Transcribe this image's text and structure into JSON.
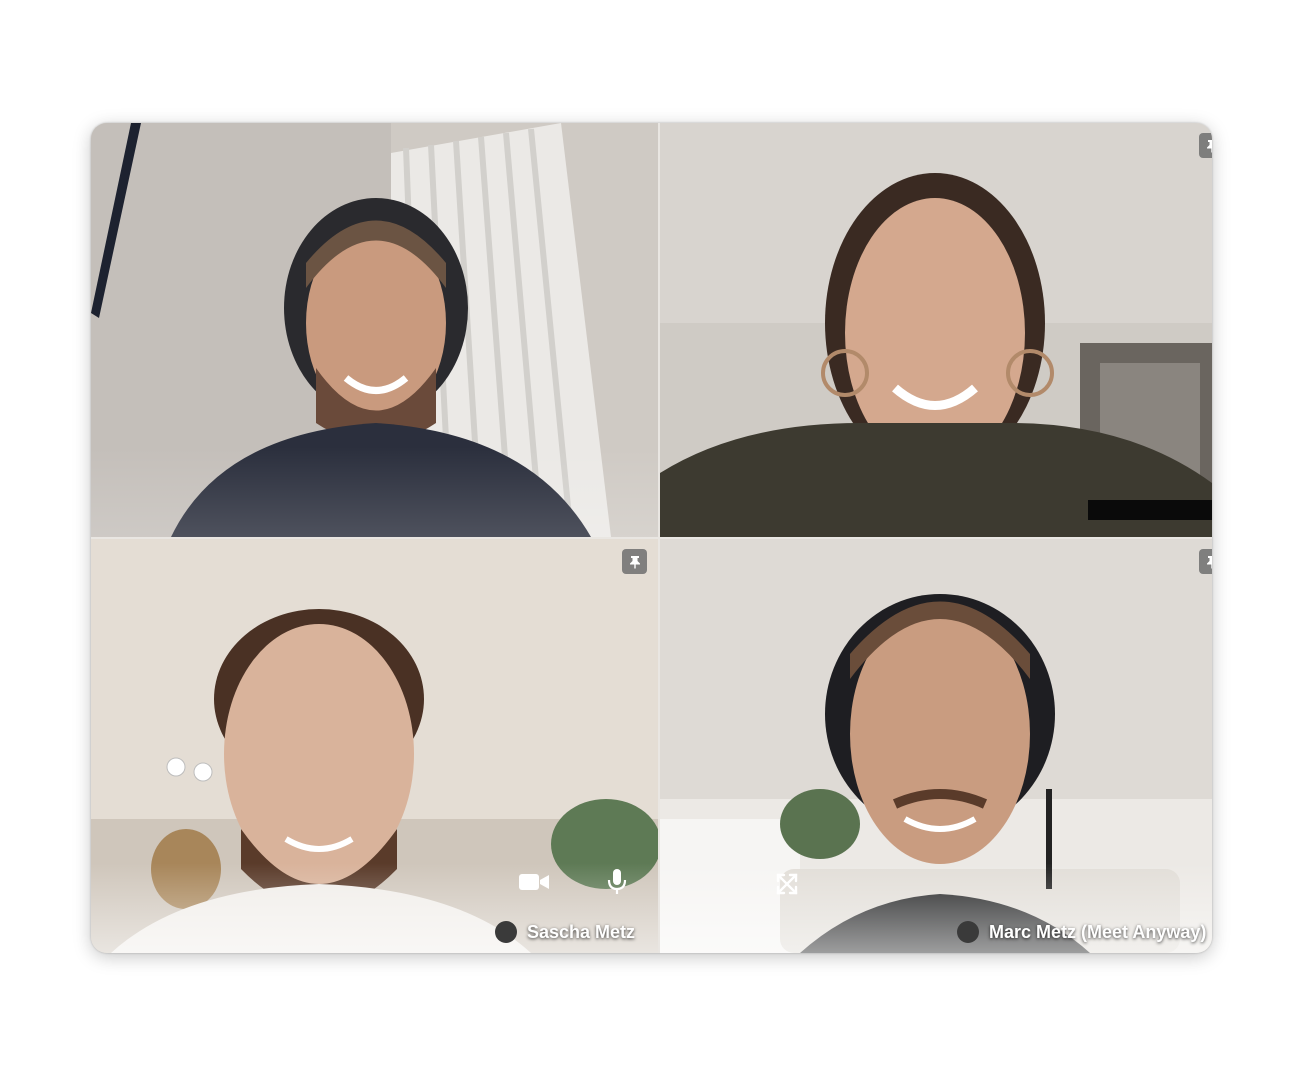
{
  "participants": [
    {
      "id": "top-left",
      "name": "",
      "pinned": false
    },
    {
      "id": "top-right",
      "name": "",
      "pinned": true
    },
    {
      "id": "bottom-left",
      "name": "Sascha Metz",
      "pinned": true
    },
    {
      "id": "bottom-right",
      "name": "Marc Metz (Meet Anyway)",
      "pinned": true
    }
  ],
  "controls": {
    "camera_icon": "video-camera-icon",
    "mic_icon": "microphone-icon",
    "fullscreen_icon": "expand-icon",
    "pin_icon": "pin-icon"
  },
  "colors": {
    "pin_bg": "#6e6e6e",
    "name_text": "#ffffff",
    "avatar_dot": "#3a3a3a"
  }
}
